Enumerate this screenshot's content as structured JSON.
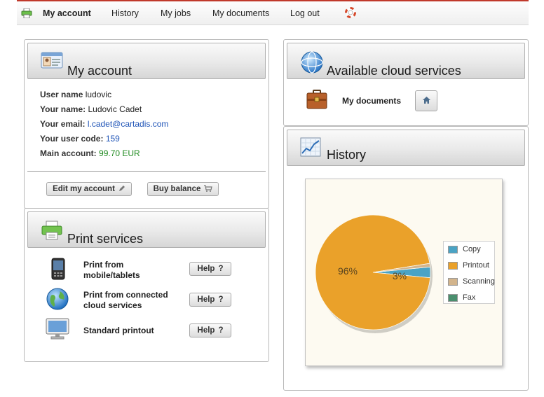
{
  "nav": {
    "items": [
      {
        "label": "My account",
        "active": true
      },
      {
        "label": "History"
      },
      {
        "label": "My jobs"
      },
      {
        "label": "My documents"
      },
      {
        "label": "Log out"
      }
    ],
    "app_icon": "printer-icon",
    "help_icon": "lifebuoy-icon"
  },
  "account": {
    "title": "My account",
    "icon": "id-card-icon",
    "user_name_label": "User name",
    "user_name_value": "ludovic",
    "your_name_label": "Your name:",
    "your_name_value": "Ludovic Cadet",
    "email_label": "Your email:",
    "email_value": "l.cadet@cartadis.com",
    "user_code_label": "Your user code:",
    "user_code_value": "159",
    "main_account_label": "Main account:",
    "main_account_value": "99.70 EUR",
    "edit_button": "Edit my account",
    "buy_button": "Buy balance"
  },
  "print": {
    "title": "Print services",
    "icon": "printer-icon",
    "items": [
      {
        "label": "Print from mobile/tablets",
        "icon": "mobile-phone-icon",
        "help": "Help"
      },
      {
        "label": "Print from connected cloud services",
        "icon": "globe-icon",
        "help": "Help"
      },
      {
        "label": "Standard printout",
        "icon": "monitor-icon",
        "help": "Help"
      }
    ]
  },
  "cloud": {
    "title": "Available cloud services",
    "icon": "globe-icon",
    "docs_label": "My documents",
    "docs_icon": "briefcase-icon",
    "home_icon": "home-icon"
  },
  "history": {
    "title": "History",
    "icon": "line-chart-icon"
  },
  "colors": {
    "copy": "#4aa3c4",
    "printout": "#eaa12a",
    "scanning": "#d2b48c",
    "fax": "#4a8f6e",
    "accent_red": "#c0392b"
  },
  "chart_data": {
    "type": "pie",
    "categories": [
      "Copy",
      "Printout",
      "Scanning",
      "Fax"
    ],
    "values": [
      3,
      96,
      1,
      0
    ],
    "data_labels": [
      "3%",
      "96%",
      "",
      ""
    ],
    "legend": "right",
    "title": ""
  }
}
